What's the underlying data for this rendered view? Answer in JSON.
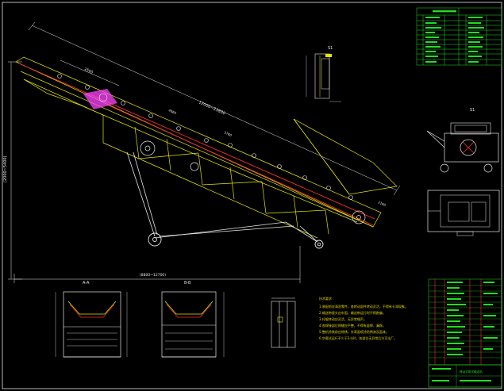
{
  "dimensions": {
    "belt_length": "12000~23800",
    "top_segment": "2500",
    "side_height": "(2000~5400)",
    "bottom_length": "(8800~12700)",
    "mid_a": "3760",
    "mid_b": "4660",
    "tail": "2160"
  },
  "views": {
    "section_a": "A-A",
    "section_b": "B-B",
    "view_s1": "S1",
    "view_s2": "S1"
  },
  "notes": {
    "heading": "技术要求",
    "lines": [
      "1.装配前应清洗零件，各转动部件转动灵活，不得有卡滞现象。",
      "2.输送带接头应牢固，输送带运行时不得跑偏。",
      "3.托辊转动应灵活，无异常噪声。",
      "4.各焊接部位焊缝应平整，不得有虚焊、漏焊。",
      "5.整机涂装前应除锈，外表面喷涂防锈漆及面漆。",
      "6.空载试运行不少于2小时，各部位无异常后方可出厂。"
    ]
  },
  "title_block": {
    "company": "移动式带式输送机"
  },
  "colors": {
    "background": "#000000",
    "frame": "#e6e6e6",
    "structure": "#e6e600",
    "belt": "#ff3030",
    "table": "#22dd22",
    "bom_line": "#ff2222",
    "highlight": "#ff44ff"
  }
}
